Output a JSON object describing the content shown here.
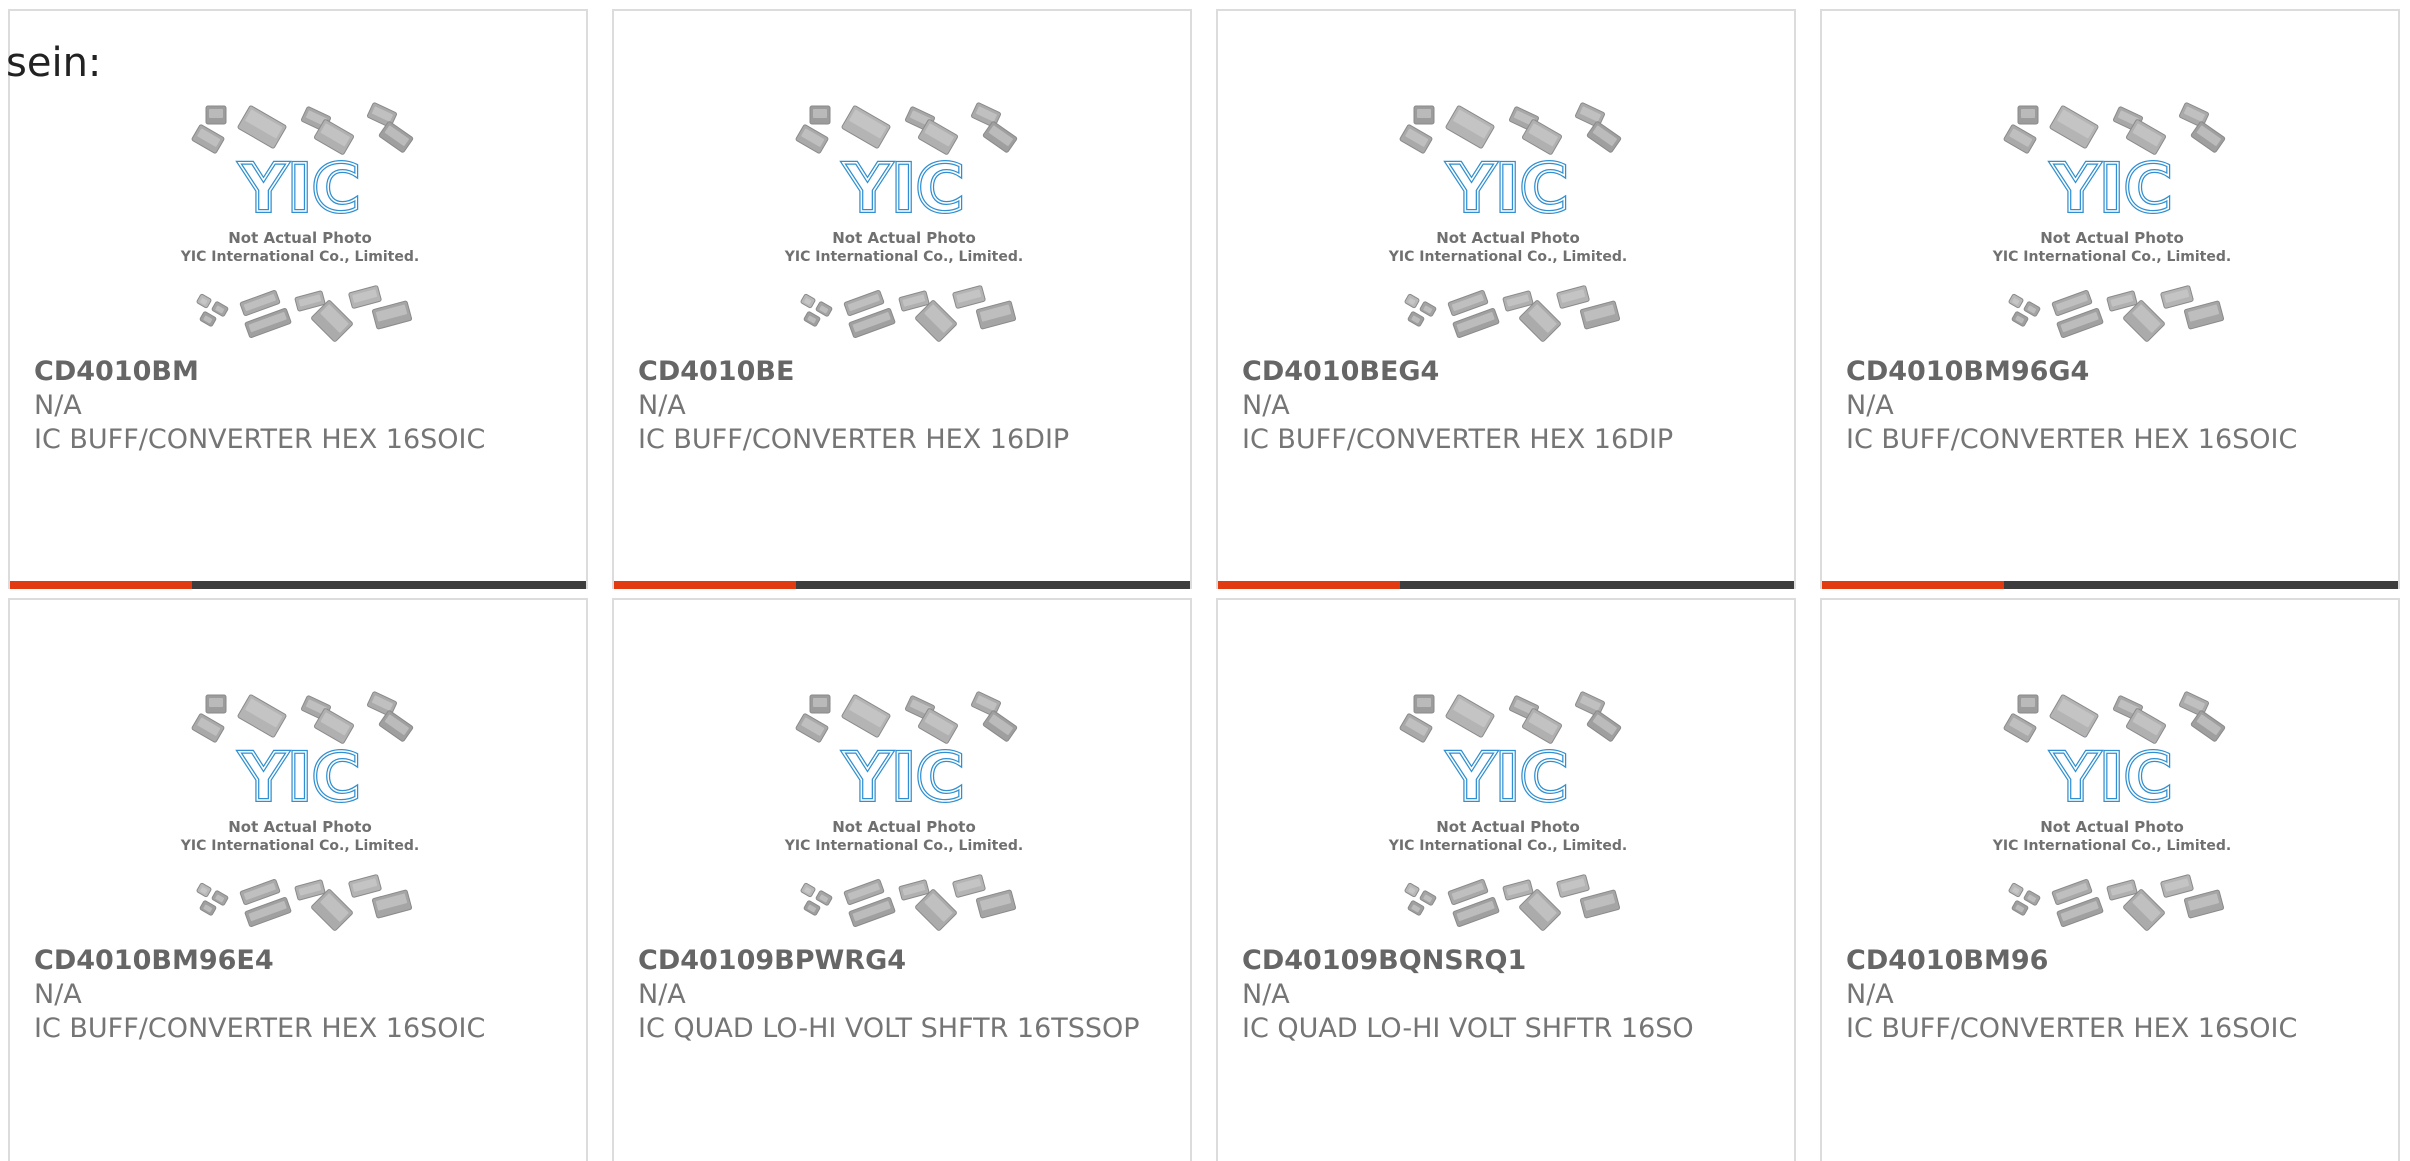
{
  "stray_label": "sein:",
  "photo": {
    "line1": "Not Actual Photo",
    "line2": "YIC International Co., Limited.",
    "logo_text": "YIC"
  },
  "colors": {
    "accent": "#e23b12",
    "bar": "#3d3d3d",
    "logo_blue": "#2f8fd0",
    "text": "#757575"
  },
  "products": [
    {
      "part": "CD4010BM",
      "mfr": "N/A",
      "desc": "IC BUFF/CONVERTER HEX 16SOIC"
    },
    {
      "part": "CD4010BE",
      "mfr": "N/A",
      "desc": "IC BUFF/CONVERTER HEX 16DIP"
    },
    {
      "part": "CD4010BEG4",
      "mfr": "N/A",
      "desc": "IC BUFF/CONVERTER HEX 16DIP"
    },
    {
      "part": "CD4010BM96G4",
      "mfr": "N/A",
      "desc": "IC BUFF/CONVERTER HEX 16SOIC"
    },
    {
      "part": "CD4010BM96E4",
      "mfr": "N/A",
      "desc": "IC BUFF/CONVERTER HEX 16SOIC"
    },
    {
      "part": "CD40109BPWRG4",
      "mfr": "N/A",
      "desc": "IC QUAD LO-HI VOLT SHFTR 16TSSOP"
    },
    {
      "part": "CD40109BQNSRQ1",
      "mfr": "N/A",
      "desc": "IC QUAD LO-HI VOLT SHFTR 16SO"
    },
    {
      "part": "CD4010BM96",
      "mfr": "N/A",
      "desc": "IC BUFF/CONVERTER HEX 16SOIC"
    }
  ]
}
